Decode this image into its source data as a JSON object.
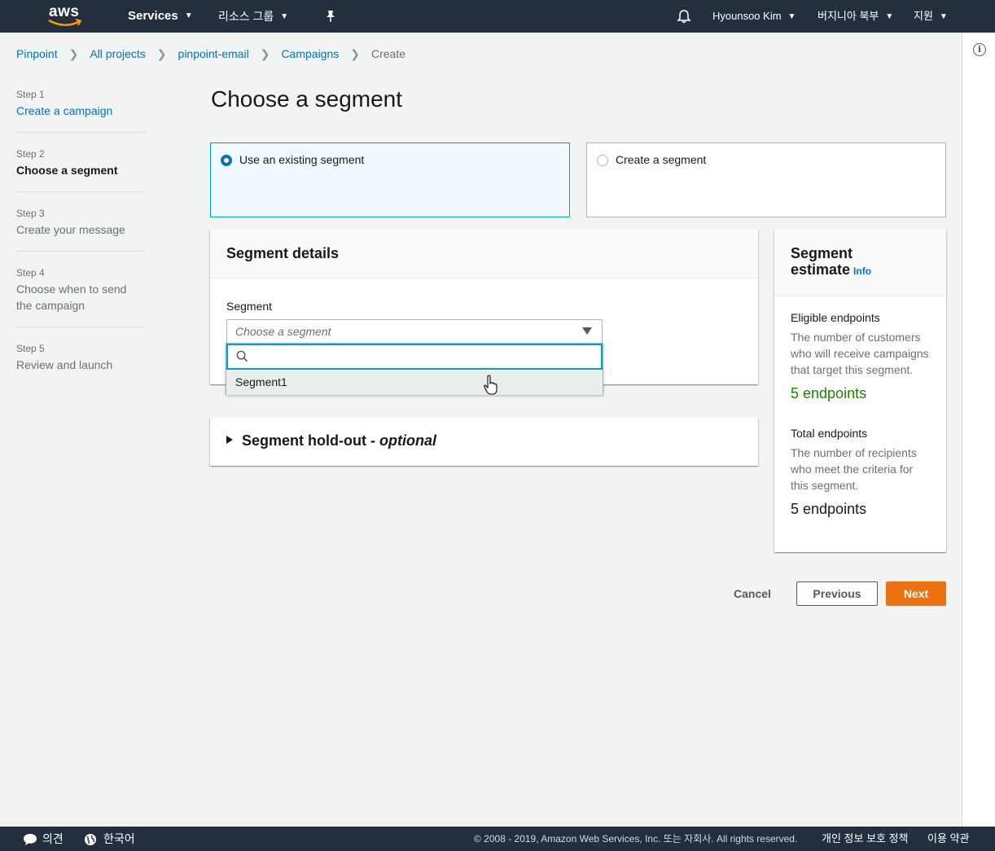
{
  "topnav": {
    "logo": "aws",
    "services": "Services",
    "resource_groups": "리소스 그룹",
    "pin_icon": "pushpin-icon",
    "bell_icon": "bell-icon",
    "user": "Hyounsoo Kim",
    "region": "버지니아 북부",
    "support": "지원"
  },
  "breadcrumb": {
    "items": [
      "Pinpoint",
      "All projects",
      "pinpoint-email",
      "Campaigns"
    ],
    "current": "Create"
  },
  "steps": [
    {
      "num": "Step 1",
      "title": "Create a campaign"
    },
    {
      "num": "Step 2",
      "title": "Choose a segment"
    },
    {
      "num": "Step 3",
      "title": "Create your message"
    },
    {
      "num": "Step 4",
      "title": "Choose when to send the campaign"
    },
    {
      "num": "Step 5",
      "title": "Review and launch"
    }
  ],
  "page_title": "Choose a segment",
  "tiles": {
    "existing": "Use an existing segment",
    "create": "Create a segment"
  },
  "segment_details": {
    "header": "Segment details",
    "field_label": "Segment",
    "placeholder": "Choose a segment",
    "option": "Segment1"
  },
  "holdout": {
    "title": "Segment hold-out - ",
    "optional": "optional"
  },
  "estimate": {
    "title_line1": "Segment",
    "title_line2": "estimate",
    "info": "Info",
    "eligible_label": "Eligible endpoints",
    "eligible_desc": "The number of customers who will receive campaigns that target this segment.",
    "eligible_value": "5 endpoints",
    "total_label": "Total endpoints",
    "total_desc": "The number of recipients who meet the criteria for this segment.",
    "total_value": "5 endpoints"
  },
  "buttons": {
    "cancel": "Cancel",
    "previous": "Previous",
    "next": "Next"
  },
  "footer": {
    "feedback": "의견",
    "language": "한국어",
    "copyright": "© 2008 - 2019, Amazon Web Services, Inc. 또는 자회사. All rights reserved.",
    "privacy": "개인 정보 보호 정책",
    "terms": "이용 약관"
  },
  "colors": {
    "nav_bg": "#232f3e",
    "link": "#0073bb",
    "primary_button": "#ec7211",
    "success": "#1d8102",
    "selected_tile_border": "#00a1c9"
  }
}
